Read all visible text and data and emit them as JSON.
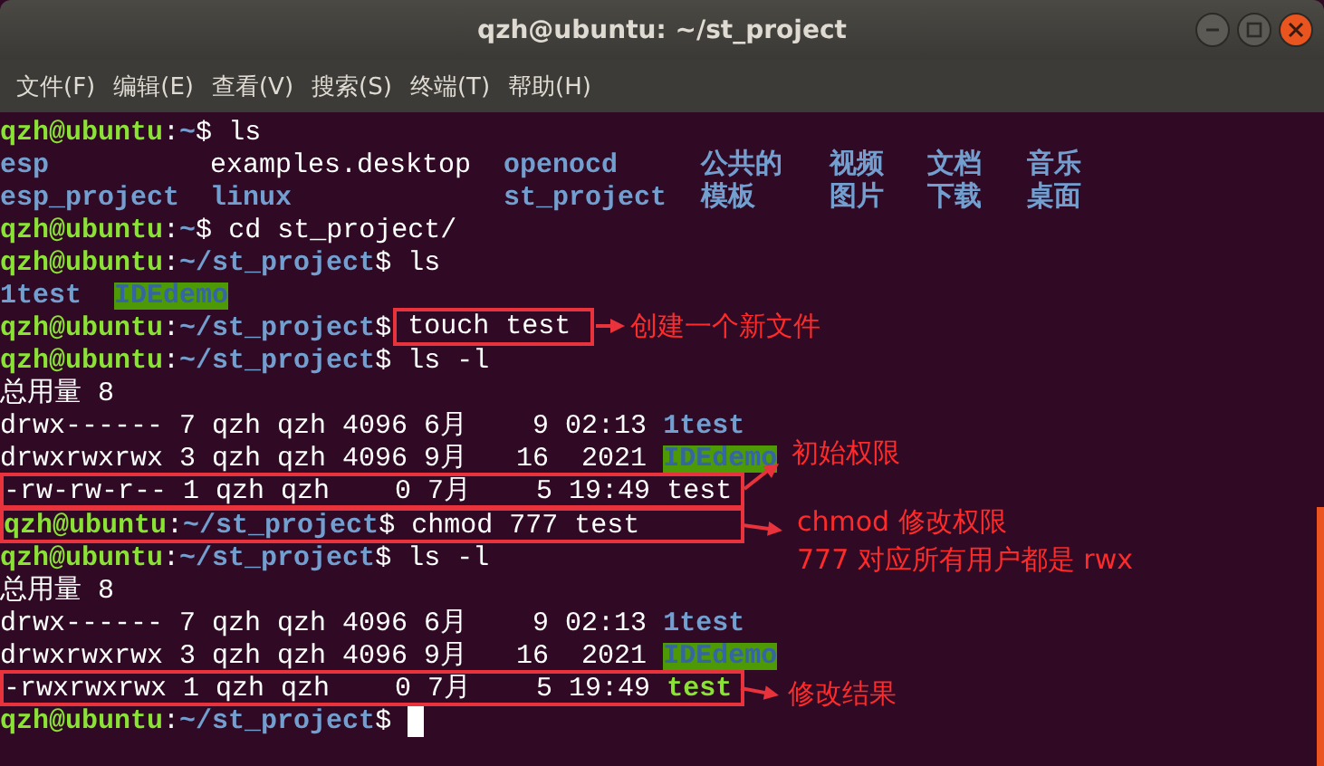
{
  "window": {
    "title": "qzh@ubuntu: ~/st_project"
  },
  "menu": [
    "文件(F)",
    "编辑(E)",
    "查看(V)",
    "搜索(S)",
    "终端(T)",
    "帮助(H)"
  ],
  "lines": [
    {
      "kind": "prompt",
      "user": "qzh@ubuntu",
      "sep": ":",
      "path": "~",
      "sign": "$",
      "command": "ls",
      "cursor": false
    },
    {
      "kind": "listing",
      "cells": [
        {
          "name": "esp",
          "kind": "dir"
        },
        {
          "name": "examples.desktop",
          "kind": "file"
        },
        {
          "name": "openocd",
          "kind": "dir"
        },
        {
          "name": "公共的",
          "kind": "dir"
        },
        {
          "name": "视频",
          "kind": "dir"
        },
        {
          "name": "文档",
          "kind": "dir"
        },
        {
          "name": "音乐",
          "kind": "dir"
        }
      ]
    },
    {
      "kind": "listing",
      "cells": [
        {
          "name": "esp_project",
          "kind": "dir"
        },
        {
          "name": "linux",
          "kind": "dir"
        },
        {
          "name": "st_project",
          "kind": "dir"
        },
        {
          "name": "模板",
          "kind": "dir"
        },
        {
          "name": "图片",
          "kind": "dir"
        },
        {
          "name": "下载",
          "kind": "dir"
        },
        {
          "name": "桌面",
          "kind": "dir"
        }
      ]
    },
    {
      "kind": "prompt",
      "user": "qzh@ubuntu",
      "sep": ":",
      "path": "~",
      "sign": "$",
      "command": "cd st_project/",
      "cursor": false
    },
    {
      "kind": "prompt",
      "user": "qzh@ubuntu",
      "sep": ":",
      "path": "~/st_project",
      "sign": "$",
      "command": "ls",
      "cursor": false
    },
    {
      "kind": "short",
      "cells": [
        {
          "name": "1test",
          "kind": "dir"
        },
        {
          "name": "IDEdemo",
          "kind": "dirhl"
        }
      ]
    },
    {
      "kind": "prompt",
      "user": "qzh@ubuntu",
      "sep": ":",
      "path": "~/st_project",
      "sign": "$",
      "command": "touch test",
      "cursor": false
    },
    {
      "kind": "prompt",
      "user": "qzh@ubuntu",
      "sep": ":",
      "path": "~/st_project",
      "sign": "$",
      "command": "ls -l",
      "cursor": false
    },
    {
      "kind": "output",
      "text": "总用量 8"
    },
    {
      "kind": "long",
      "text": "drwx------ 7 qzh qzh 4096 6月    9 02:13",
      "file": {
        "name": "1test",
        "kind": "dir"
      }
    },
    {
      "kind": "long",
      "text": "drwxrwxrwx 3 qzh qzh 4096 9月   16  2021",
      "file": {
        "name": "IDEdemo",
        "kind": "dirhl"
      }
    },
    {
      "kind": "long",
      "text": "-rw-rw-r-- 1 qzh qzh    0 7月    5 19:49",
      "file": {
        "name": "test",
        "kind": "file"
      }
    },
    {
      "kind": "prompt",
      "user": "qzh@ubuntu",
      "sep": ":",
      "path": "~/st_project",
      "sign": "$",
      "command": "chmod 777 test",
      "cursor": false
    },
    {
      "kind": "prompt",
      "user": "qzh@ubuntu",
      "sep": ":",
      "path": "~/st_project",
      "sign": "$",
      "command": "ls -l",
      "cursor": false
    },
    {
      "kind": "output",
      "text": "总用量 8"
    },
    {
      "kind": "long",
      "text": "drwx------ 7 qzh qzh 4096 6月    9 02:13",
      "file": {
        "name": "1test",
        "kind": "dir"
      }
    },
    {
      "kind": "long",
      "text": "drwxrwxrwx 3 qzh qzh 4096 9月   16  2021",
      "file": {
        "name": "IDEdemo",
        "kind": "dirhl"
      }
    },
    {
      "kind": "long",
      "text": "-rwxrwxrwx 1 qzh qzh    0 7月    5 19:49",
      "file": {
        "name": "test",
        "kind": "exec"
      }
    },
    {
      "kind": "prompt",
      "user": "qzh@ubuntu",
      "sep": ":",
      "path": "~/st_project",
      "sign": "$",
      "cursor": true
    }
  ],
  "annotations": [
    {
      "lines": [
        "创建一个新文件"
      ]
    },
    {
      "lines": [
        "初始权限"
      ]
    },
    {
      "lines": [
        "chmod 修改权限",
        "777 对应所有用户都是 rwx"
      ]
    },
    {
      "lines": [
        "修改结果"
      ]
    }
  ]
}
